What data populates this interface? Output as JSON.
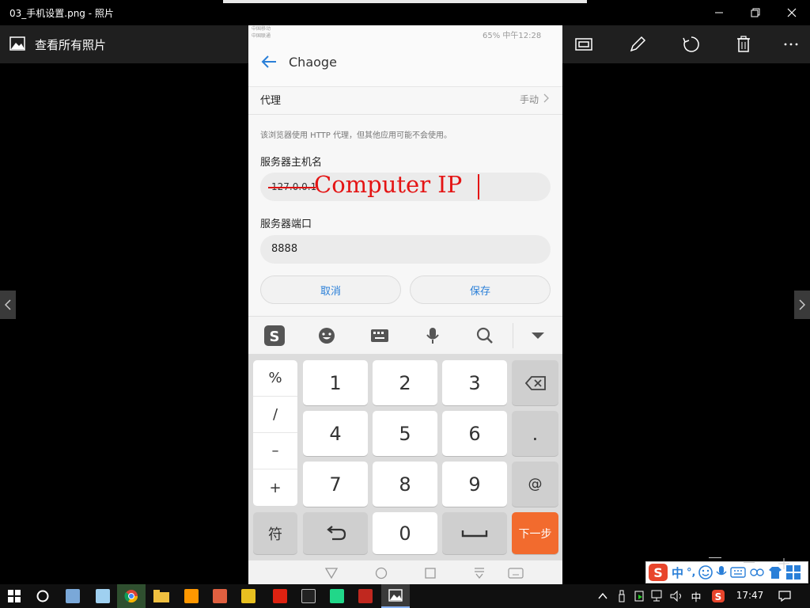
{
  "window": {
    "title": "03_手机设置.png - 照片"
  },
  "toolbar": {
    "see_all": "查看所有照片"
  },
  "phone": {
    "status_left_1": "中国移动",
    "status_left_2": "中国联通",
    "status_right": "65%  中午12:28",
    "header_title": "Chaoge",
    "proxy_label": "代理",
    "proxy_value": "手动",
    "proxy_note": "该浏览器使用 HTTP 代理，但其他应用可能不会使用。",
    "host_label": "服务器主机名",
    "host_value": "127.0.0.1",
    "host_annotation": "Computer IP",
    "port_label": "服务器端口",
    "port_value": "8888",
    "cancel": "取消",
    "save": "保存",
    "keys": {
      "sym": [
        "%",
        "/",
        "–",
        "+"
      ],
      "fu": "符",
      "digits": [
        "1",
        "2",
        "3",
        "4",
        "5",
        "6",
        "7",
        "8",
        "9",
        "0"
      ],
      "dot": ".",
      "at": "@",
      "next": "下一步"
    }
  },
  "ime": {
    "zh": "中",
    "punct": "°,"
  },
  "taskbar": {
    "lang": "中",
    "time": "17:47"
  },
  "colors": {
    "accent": "#2a7fd8",
    "orange": "#f26b2e",
    "sogou": "#e8452c"
  }
}
